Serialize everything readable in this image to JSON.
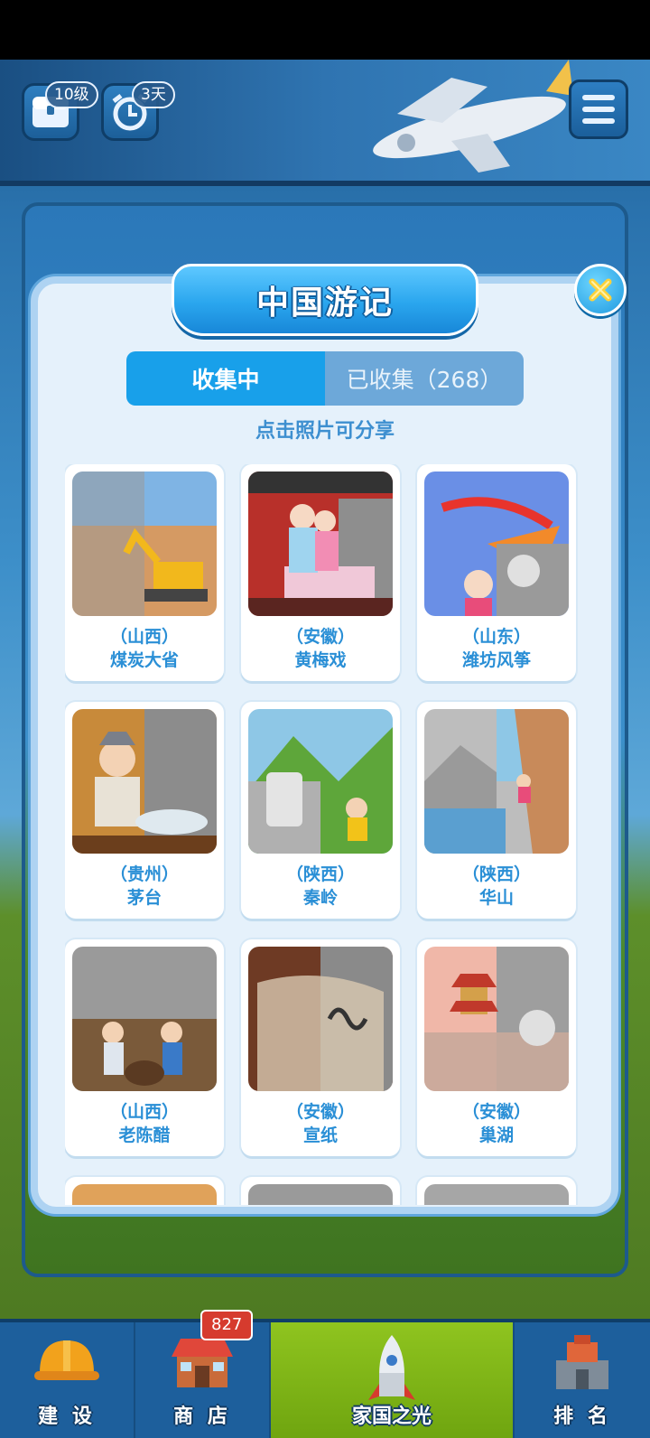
{
  "hud": {
    "level_badge": "10级",
    "days_badge": "3天"
  },
  "modal": {
    "title": "中国游记",
    "tabs": [
      {
        "label": "收集中",
        "active": true
      },
      {
        "label": "已收集（268）",
        "active": false
      }
    ],
    "hint": "点击照片可分享",
    "cards": [
      {
        "region": "（山西）",
        "name": "煤炭大省",
        "icon": "excavator-desert-photo"
      },
      {
        "region": "（安徽）",
        "name": "黄梅戏",
        "icon": "opera-stage-photo"
      },
      {
        "region": "（山东）",
        "name": "潍坊风筝",
        "icon": "kite-festival-photo"
      },
      {
        "region": "（贵州）",
        "name": "茅台",
        "icon": "liquor-brewing-photo"
      },
      {
        "region": "（陕西）",
        "name": "秦岭",
        "icon": "mountain-stone-photo"
      },
      {
        "region": "（陕西）",
        "name": "华山",
        "icon": "cliff-path-photo"
      },
      {
        "region": "（山西）",
        "name": "老陈醋",
        "icon": "vinegar-workshop-photo"
      },
      {
        "region": "（安徽）",
        "name": "宣纸",
        "icon": "calligraphy-paper-photo"
      },
      {
        "region": "（安徽）",
        "name": "巢湖",
        "icon": "pagoda-lake-photo"
      }
    ]
  },
  "bottom_nav": {
    "items": [
      {
        "label": "建 设",
        "icon": "hardhat-icon"
      },
      {
        "label": "商 店",
        "icon": "shop-icon"
      },
      {
        "label": "家国之光",
        "icon": "rocket-icon"
      },
      {
        "label": "排 名",
        "icon": "ranking-icon"
      }
    ],
    "shop_badge": "827"
  },
  "colors": {
    "accent": "#18a0ea",
    "card_text": "#2a8fd6",
    "active_nav": "#8fc41f"
  }
}
